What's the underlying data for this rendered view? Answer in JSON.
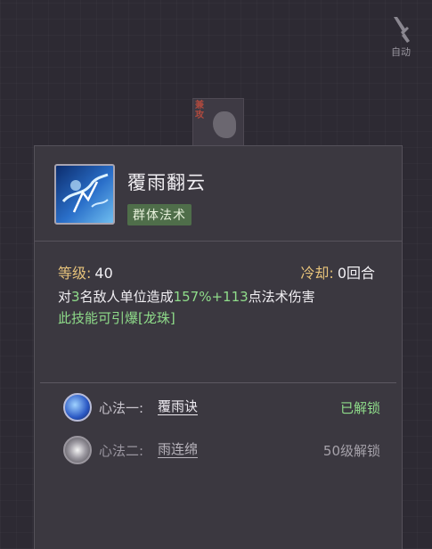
{
  "auto_button": {
    "label": "自动"
  },
  "skill_tag_bg": {
    "text": "兼攻"
  },
  "skill": {
    "name": "覆雨翻云",
    "type": "群体法术",
    "level_label": "等级:",
    "level_value": "40",
    "cooldown_label": "冷却:",
    "cooldown_value": "0回合",
    "desc_prefix": "对",
    "desc_count": "3",
    "desc_mid": "名敌人单位造成",
    "desc_damage": "157%+113",
    "desc_suffix": "点法术伤害",
    "extra_line": "此技能可引爆[龙珠]"
  },
  "xinfa": [
    {
      "label": "心法一:",
      "name": "覆雨诀",
      "status": "已解锁",
      "icon": "rain-xinfa-icon"
    },
    {
      "label": "心法二:",
      "name": "雨连绵",
      "status": "50级解锁",
      "icon": "swirl-xinfa-icon"
    }
  ],
  "colors": {
    "gold": "#e6c27a",
    "green": "#8fdc8a",
    "panel_bg": "#3b3840"
  }
}
